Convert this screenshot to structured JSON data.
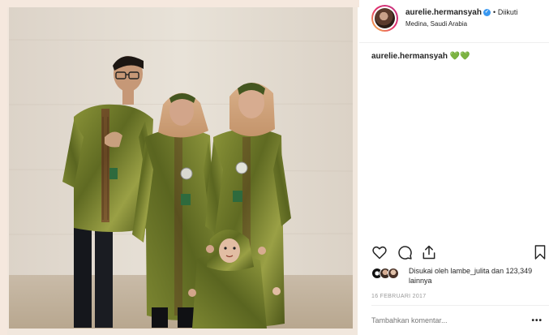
{
  "post": {
    "username": "aurelie.hermansyah",
    "follow_dot": "•",
    "follow_status": "Diikuti",
    "location": "Medina, Saudi Arabia",
    "caption_user": "aurelie.hermansyah",
    "caption_text": "💚💚",
    "likes_text": "Disukai oleh lambe_julita dan 123,349 lainnya",
    "date": "16 FEBRUARI 2017",
    "comment_placeholder": "Tambahkan komentar...",
    "more_label": "•••"
  },
  "colors": {
    "background": "#f7ebe2",
    "verified": "#3897f0",
    "text": "#262626",
    "muted": "#999999",
    "outfit_green": "#6f7a2a"
  },
  "icons": {
    "like": "heart-icon",
    "comment": "comment-icon",
    "share": "share-icon",
    "save": "bookmark-icon",
    "verified": "verified-badge-icon",
    "more": "more-options-icon"
  }
}
